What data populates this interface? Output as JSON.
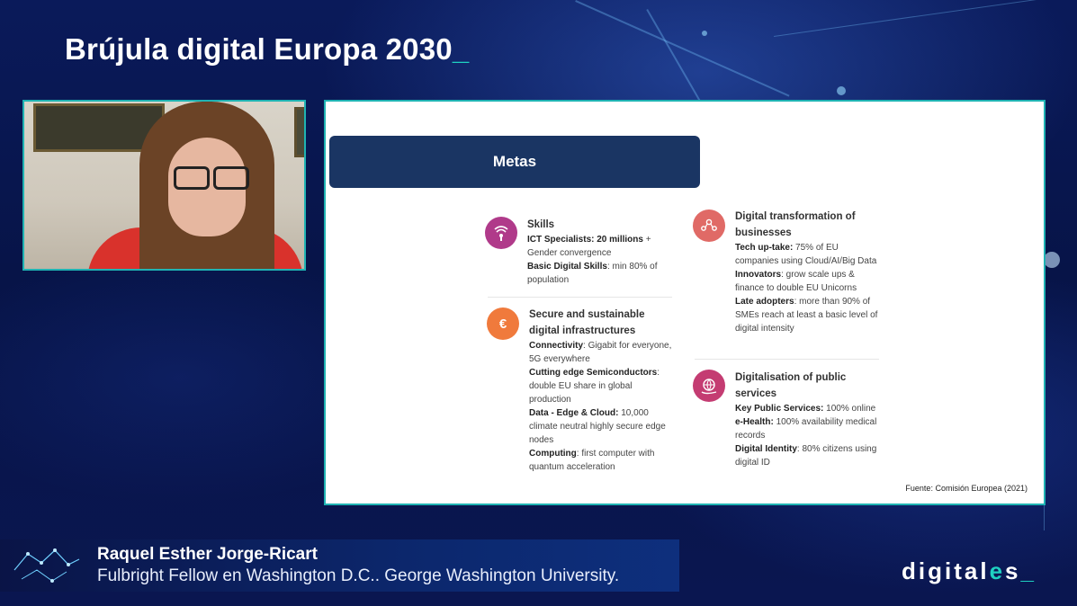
{
  "header": {
    "title": "Brújula digital Europa 2030",
    "cursor": "_"
  },
  "slide": {
    "heading": "Metas",
    "skills": {
      "icon": "wifi-signal-icon",
      "title": "Skills",
      "ict_label": "ICT Specialists: 20 millions",
      "ict_rest": " + Gender convergence",
      "basic_label": "Basic Digital Skills",
      "basic_rest": ": min 80% of population"
    },
    "infra": {
      "icon": "euro-coin-icon",
      "title": "Secure and sustainable digital infrastructures",
      "connectivity_label": "Connectivity",
      "connectivity_rest": ": Gigabit for everyone, 5G everywhere",
      "semi_label": "Cutting edge Semiconductors",
      "semi_rest": ": double EU share in global production",
      "data_label": "Data - Edge & Cloud:",
      "data_rest": " 10,000 climate neutral highly secure edge nodes",
      "computing_label": "Computing",
      "computing_rest": ": first computer with quantum acceleration"
    },
    "business": {
      "icon": "people-network-icon",
      "title": "Digital transformation of businesses",
      "tech_label": "Tech up-take:",
      "tech_rest": " 75% of EU companies using Cloud/AI/Big Data",
      "innov_label": "Innovators",
      "innov_rest": ": grow scale ups & finance to double EU Unicorns",
      "late_label": "Late adopters",
      "late_rest": ": more than 90% of SMEs reach at least a basic level of digital intensity"
    },
    "public": {
      "icon": "globe-hand-icon",
      "title": "Digitalisation of public services",
      "key_label": "Key Public Services:",
      "key_rest": " 100% online",
      "health_label": "e-Health:",
      "health_rest": " 100% availability medical records",
      "id_label": "Digital Identity",
      "id_rest": ": 80% citizens using digital ID"
    },
    "source": "Fuente: Comisión Europea (2021)"
  },
  "lower_third": {
    "name": "Raquel Esther Jorge-Ricart",
    "role": "Fulbright Fellow en Washington D.C.. George Washington University."
  },
  "brand": {
    "left": "digital",
    "mark": "e",
    "right": "s",
    "cursor": "_"
  },
  "colors": {
    "accent": "#1fd1c1",
    "slide_bar": "#1a3563",
    "skills_icon": "#b03a8a",
    "infra_icon": "#f07a3c",
    "business_icon": "#e06a66",
    "public_icon": "#c43c72"
  }
}
